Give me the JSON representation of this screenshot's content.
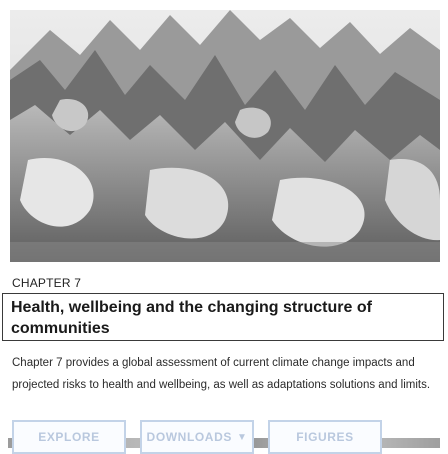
{
  "hero": {
    "icon": "melting-ice-image"
  },
  "chapter": {
    "eyebrow": "CHAPTER 7",
    "title": "Health, wellbeing and the changing structure of communities",
    "description": "Chapter 7 provides a global assessment of current climate change impacts and projected risks to health and wellbeing, as well as adaptations solutions and limits."
  },
  "actions": [
    {
      "label": "EXPLORE",
      "has_dropdown": false
    },
    {
      "label": "DOWNLOADS",
      "has_dropdown": true,
      "icon": "chevron-down-icon"
    },
    {
      "label": "FIGURES",
      "has_dropdown": false
    }
  ],
  "colors": {
    "button_border": "#c3d3e8",
    "button_text": "#b9c8de",
    "title_border": "#3a3a3a"
  }
}
